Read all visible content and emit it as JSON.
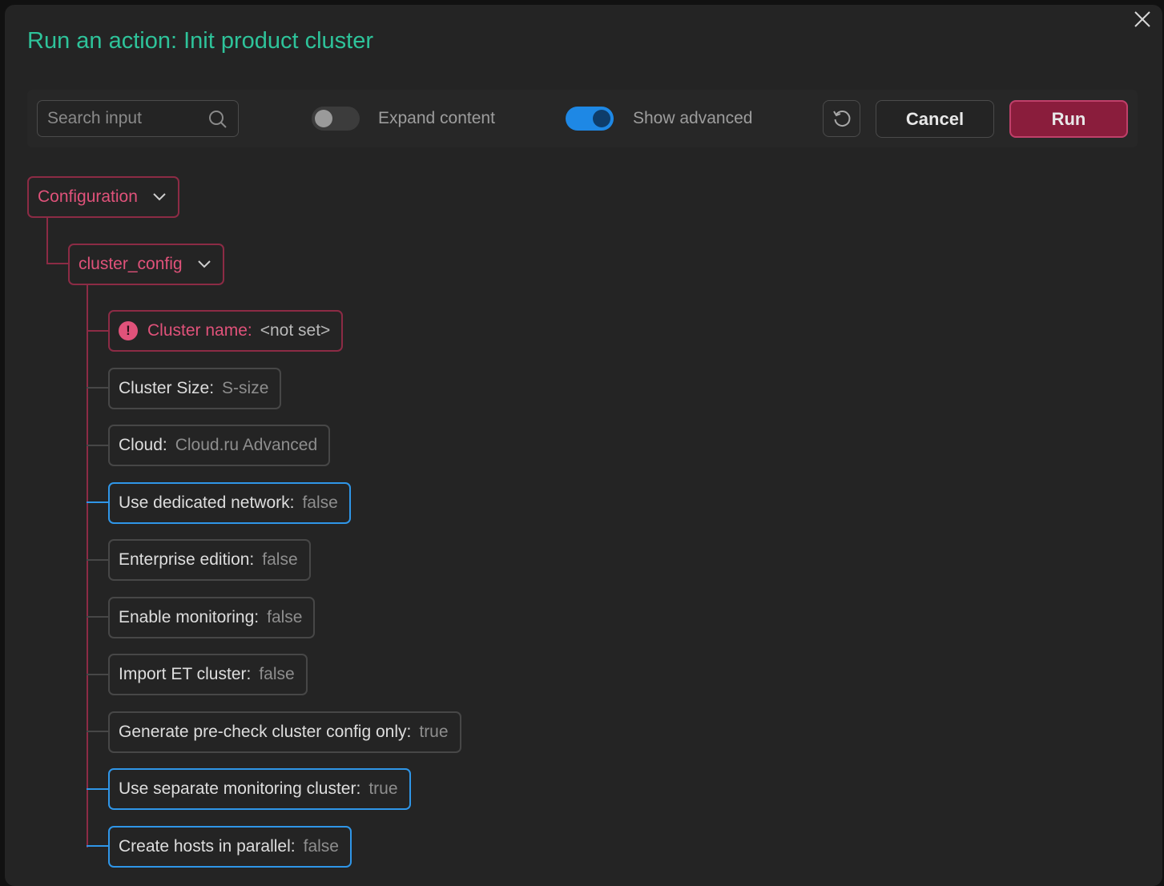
{
  "dialog": {
    "title": "Run an action: Init product cluster",
    "close_icon": "close-icon"
  },
  "toolbar": {
    "search_placeholder": "Search input",
    "search_value": "",
    "expand_label": "Expand content",
    "expand_on": false,
    "advanced_label": "Show advanced",
    "advanced_on": true,
    "reset_icon": "reset-icon",
    "cancel_label": "Cancel",
    "run_label": "Run"
  },
  "tree": {
    "root": {
      "label": "Configuration",
      "icon": "chevron-down-icon"
    },
    "group": {
      "label": "cluster_config",
      "icon": "chevron-down-icon"
    },
    "fields": [
      {
        "label": "Cluster name:",
        "value": "<not set>",
        "status": "error"
      },
      {
        "label": "Cluster Size:",
        "value": "S-size",
        "status": "normal"
      },
      {
        "label": "Cloud:",
        "value": "Cloud.ru Advanced",
        "status": "normal"
      },
      {
        "label": "Use dedicated network:",
        "value": "false",
        "status": "advanced"
      },
      {
        "label": "Enterprise edition:",
        "value": "false",
        "status": "normal"
      },
      {
        "label": "Enable monitoring:",
        "value": "false",
        "status": "normal"
      },
      {
        "label": "Import ET cluster:",
        "value": "false",
        "status": "normal"
      },
      {
        "label": "Generate pre-check cluster config only:",
        "value": "true",
        "status": "normal"
      },
      {
        "label": "Use separate monitoring cluster:",
        "value": "true",
        "status": "advanced"
      },
      {
        "label": "Create hosts in parallel:",
        "value": "false",
        "status": "advanced"
      }
    ],
    "error_icon_glyph": "!"
  },
  "colors": {
    "accent_title": "#2ec39a",
    "group_border": "#8c2b45",
    "advanced_border": "#2f96e8",
    "run_bg": "#8a1d3c"
  }
}
